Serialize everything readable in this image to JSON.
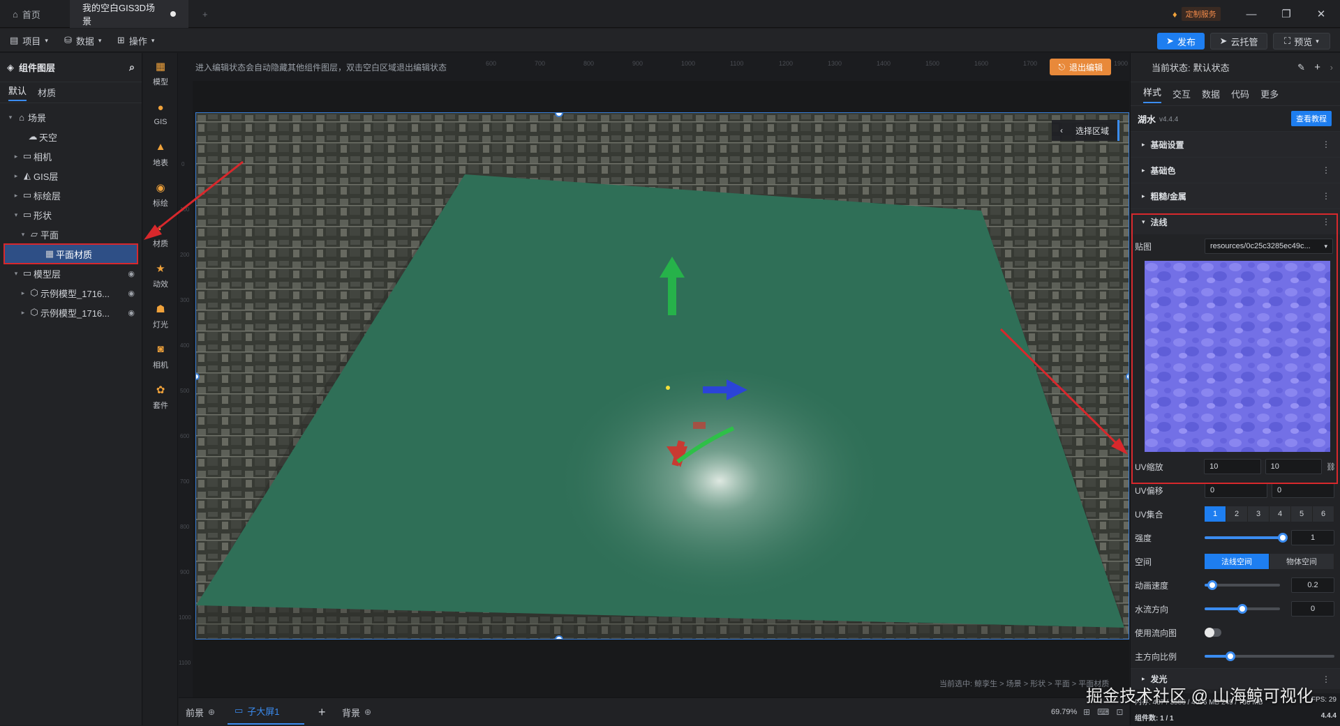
{
  "titlebar": {
    "home_tab": "首页",
    "scene_tab": "我的空白GIS3D场景",
    "add_tab": "+",
    "custom_service": "定制服务",
    "minimize": "—",
    "restore": "❐",
    "close": "✕"
  },
  "toolbar": {
    "project": "项目",
    "data": "数据",
    "operate": "操作",
    "publish": "发布",
    "cloud_hosting": "云托管",
    "preview": "预览"
  },
  "left_panel": {
    "title": "组件图层",
    "tabs": [
      "默认",
      "材质"
    ],
    "tree": [
      {
        "label": "场景",
        "arrow": "▾",
        "icon": "⌂"
      },
      {
        "label": "天空",
        "arrow": "",
        "icon": "☁"
      },
      {
        "label": "相机",
        "arrow": "▸",
        "icon": "▭"
      },
      {
        "label": "GIS层",
        "arrow": "▸",
        "icon": "◭"
      },
      {
        "label": "标绘层",
        "arrow": "▸",
        "icon": "▭"
      },
      {
        "label": "形状",
        "arrow": "▾",
        "icon": "▭"
      },
      {
        "label": "平面",
        "arrow": "▾",
        "icon": "▱"
      },
      {
        "label": "平面材质",
        "arrow": "",
        "icon": "▦"
      },
      {
        "label": "模型层",
        "arrow": "▾",
        "icon": "▭"
      },
      {
        "label": "示例模型_1716...",
        "arrow": "▸",
        "icon": "⬡"
      },
      {
        "label": "示例模型_1716...",
        "arrow": "▸",
        "icon": "⬡"
      }
    ]
  },
  "icon_bar": [
    {
      "label": "模型",
      "icon": "▦"
    },
    {
      "label": "GIS",
      "icon": "●"
    },
    {
      "label": "地表",
      "icon": "▲"
    },
    {
      "label": "标绘",
      "icon": "◉"
    },
    {
      "label": "材质",
      "icon": "◐"
    },
    {
      "label": "动效",
      "icon": "★"
    },
    {
      "label": "灯光",
      "icon": "☗"
    },
    {
      "label": "相机",
      "icon": "◙"
    },
    {
      "label": "套件",
      "icon": "✿"
    }
  ],
  "canvas": {
    "hint": "进入编辑状态会自动隐藏其他组件图层，双击空白区域退出编辑状态",
    "exit_edit": "退出编辑",
    "select_region": "选择区域",
    "ruler_top": [
      "600",
      "700",
      "800",
      "900",
      "1000",
      "1100",
      "1200",
      "1300",
      "1400",
      "1500",
      "1600",
      "1700",
      "1800",
      "1900"
    ],
    "ruler_left": [
      "0",
      "100",
      "200",
      "300",
      "400",
      "500",
      "600",
      "700",
      "800",
      "900",
      "1000",
      "1100"
    ],
    "breadcrumb": "当前选中: 鲸孪生 > 场景 > 形状 > 平面 > 平面材质"
  },
  "bottom_bar": {
    "foreground": "前景",
    "screen_tab": "子大屏1",
    "add": "+",
    "background": "背景",
    "zoom": "69.79%"
  },
  "right_panel": {
    "state_label": "当前状态:",
    "state_value": "默认状态",
    "tabs": [
      "样式",
      "交互",
      "数据",
      "代码",
      "更多"
    ],
    "component_name": "湖水",
    "version": "v4.4.4",
    "tutorial": "查看教程",
    "sections": [
      "基础设置",
      "基础色",
      "粗糙/金属",
      "法线"
    ],
    "texture_label": "贴图",
    "texture_value": "resources/0c25c3285ec49c...",
    "uv_scale_label": "UV缩放",
    "uv_scale_x": "10",
    "uv_scale_y": "10",
    "uv_offset_label": "UV偏移",
    "uv_offset_x": "0",
    "uv_offset_y": "0",
    "uv_set_label": "UV集合",
    "uv_set_options": [
      "1",
      "2",
      "3",
      "4",
      "5",
      "6"
    ],
    "strength_label": "强度",
    "strength_value": "1",
    "strength_level": 1.0,
    "space_label": "空间",
    "space_options": [
      "法线空间",
      "物体空间"
    ],
    "anim_speed_label": "动画速度",
    "anim_speed_value": "0.2",
    "anim_speed_level": 0.1,
    "flow_dir_label": "水流方向",
    "flow_dir_value": "0",
    "flow_dir_level": 0.5,
    "use_flow_map_label": "使用流向图",
    "main_dir_ratio_label": "主方向比例",
    "main_dir_ratio_level": 0.2,
    "emission_label": "发光",
    "status_line1": "内存: 487 / 3586 / 4096 MB 249 / 730 MB",
    "status_fps": "FPS: 29",
    "status_components": "组件数: 1 / 1",
    "status_version": "4.4.4"
  },
  "watermark": "掘金技术社区 @ 山海鲸可视化",
  "colors": {
    "accent": "#3b8cf0",
    "exit_button": "#e8893a",
    "highlight_red": "#d8282c",
    "water": "#2f6f57"
  }
}
